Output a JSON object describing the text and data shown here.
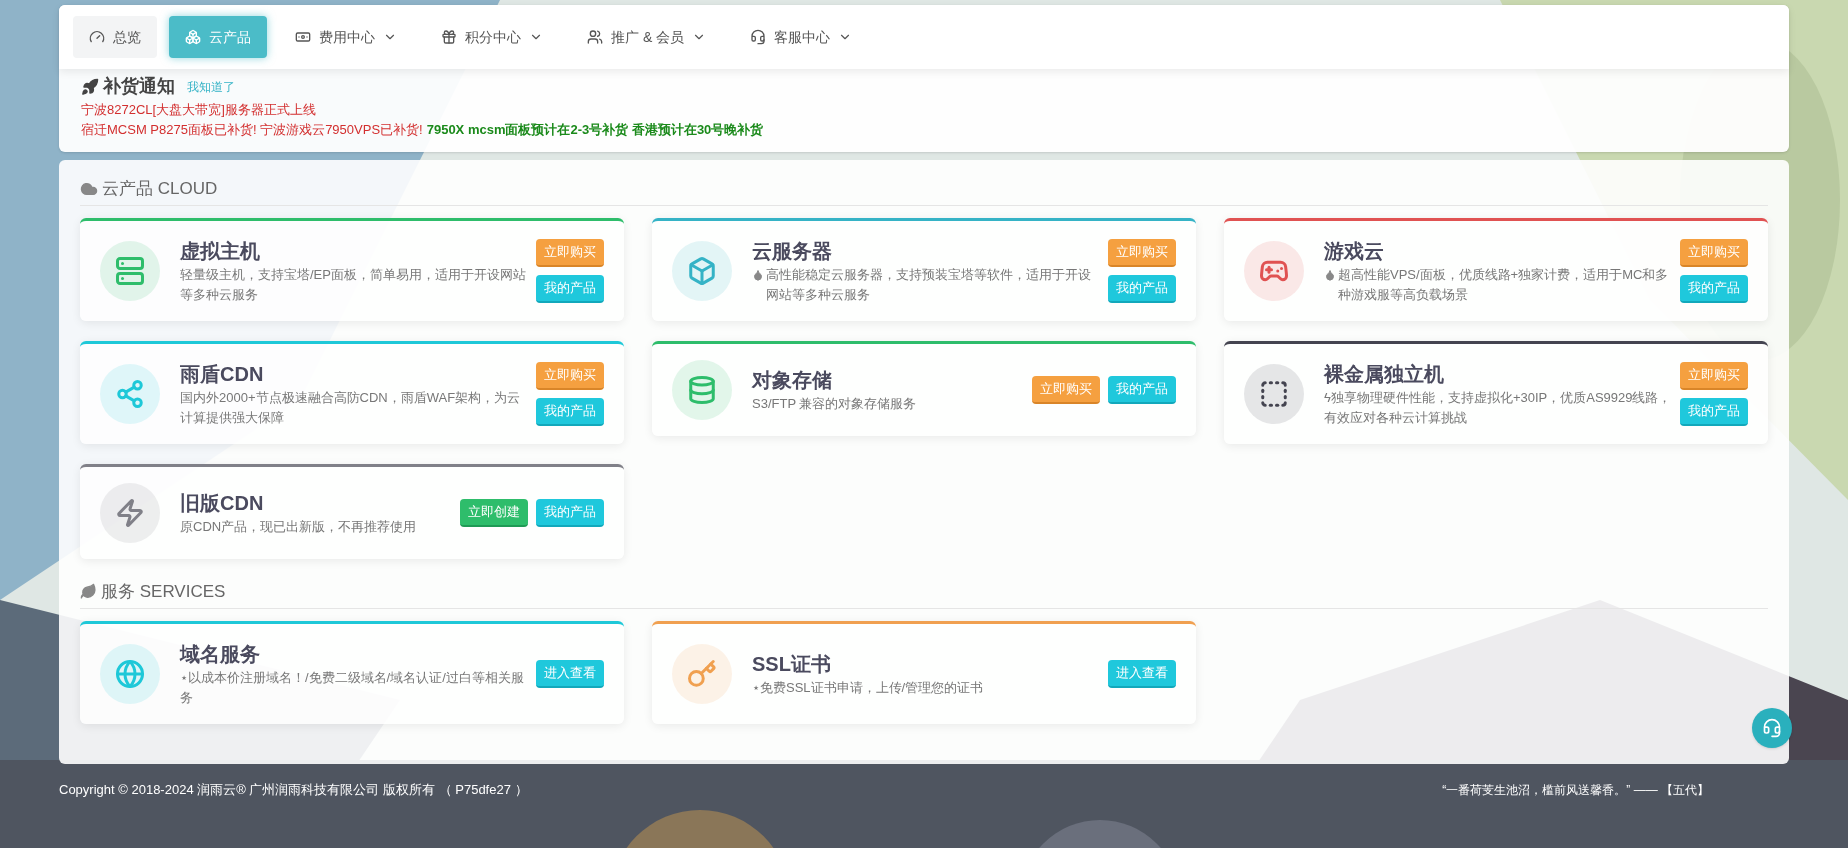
{
  "nav": [
    {
      "label": "总览",
      "selected": false,
      "dropdown": false
    },
    {
      "label": "云产品",
      "selected": true,
      "dropdown": false
    },
    {
      "label": "费用中心",
      "selected": false,
      "dropdown": true
    },
    {
      "label": "积分中心",
      "selected": false,
      "dropdown": true
    },
    {
      "label": "推广 & 会员",
      "selected": false,
      "dropdown": true
    },
    {
      "label": "客服中心",
      "selected": false,
      "dropdown": true
    }
  ],
  "notice": {
    "title": "补货通知",
    "dismiss": "我知道了",
    "lines": [
      {
        "segments": [
          {
            "text": "宁波8272CL[大盘大带宽]服务器正式上线",
            "color": "#d32f2f",
            "bold": false
          }
        ]
      },
      {
        "segments": [
          {
            "text": "宿迁MCSM P8275面板已补货! 宁波游戏云7950VPS已补货!",
            "color": "#d32f2f",
            "bold": false
          },
          {
            "text": "7950X mcsm面板预计在2-3号补货 香港预计在30号晚补货",
            "color": "#1b8a1b",
            "bold": true
          }
        ]
      }
    ]
  },
  "cloud": {
    "heading": "云产品 CLOUD",
    "cards": [
      {
        "title": "虚拟主机",
        "description": "轻量级主机，支持宝塔/EP面板，简单易用，适用于开设网站等多种云服务",
        "color": "#2ebd6b",
        "buttons": [
          {
            "label": "立即购买",
            "kind": "buy"
          },
          {
            "label": "我的产品",
            "kind": "mine"
          }
        ]
      },
      {
        "title": "云服务器",
        "droplet": true,
        "description": "高性能稳定云服务器，支持预装宝塔等软件，适用于开设网站等多种云服务",
        "color": "#35b3c6",
        "buttons": [
          {
            "label": "立即购买",
            "kind": "buy"
          },
          {
            "label": "我的产品",
            "kind": "mine"
          }
        ]
      },
      {
        "title": "游戏云",
        "droplet": true,
        "description": "超高性能VPS/面板，优质线路+独家计费，适用于MC和多种游戏服等高负载场景",
        "color": "#e05252",
        "buttons": [
          {
            "label": "立即购买",
            "kind": "buy"
          },
          {
            "label": "我的产品",
            "kind": "mine"
          }
        ]
      },
      {
        "title": "雨盾CDN",
        "description": "国内外2000+节点极速融合高防CDN，雨盾WAF架构，为云计算提供强大保障",
        "color": "#1ec8d8",
        "buttons": [
          {
            "label": "立即购买",
            "kind": "buy"
          },
          {
            "label": "我的产品",
            "kind": "mine"
          }
        ]
      },
      {
        "title": "对象存储",
        "description": "S3/FTP 兼容的对象存储服务",
        "color": "#2ebd6b",
        "inline": true,
        "buttons": [
          {
            "label": "立即购买",
            "kind": "buy"
          },
          {
            "label": "我的产品",
            "kind": "mine"
          }
        ]
      },
      {
        "title": "裸金属独立机",
        "description": "ϟ独享物理硬件性能，支持虚拟化+30IP，优质AS9929线路，有效应对各种云计算挑战",
        "color": "#444450",
        "buttons": [
          {
            "label": "立即购买",
            "kind": "buy"
          },
          {
            "label": "我的产品",
            "kind": "mine"
          }
        ]
      },
      {
        "title": "旧版CDN",
        "description": "原CDN产品，现已出新版，不再推荐使用",
        "color": "#808088",
        "inline": true,
        "buttons": [
          {
            "label": "立即创建",
            "kind": "create"
          },
          {
            "label": "我的产品",
            "kind": "mine"
          }
        ]
      }
    ]
  },
  "services": {
    "heading": "服务 SERVICES",
    "cards": [
      {
        "title": "域名服务",
        "description": "⋆以成本价注册域名！/免费二级域名/域名认证/过白等相关服务",
        "color": "#1ec8d8",
        "buttons": [
          {
            "label": "进入查看",
            "kind": "view"
          }
        ]
      },
      {
        "title": "SSL证书",
        "description": "⋆免费SSL证书申请，上传/管理您的证书",
        "color": "#f0a050",
        "buttons": [
          {
            "label": "进入查看",
            "kind": "view"
          }
        ]
      }
    ]
  },
  "footer": {
    "copyright": "Copyright © 2018-2024 润雨云® 广州润雨科技有限公司 版权所有 （ P75dfe27 ）",
    "quote": "“一番荷芰生池沼，槛前风送馨香。” —— 【五代】"
  }
}
